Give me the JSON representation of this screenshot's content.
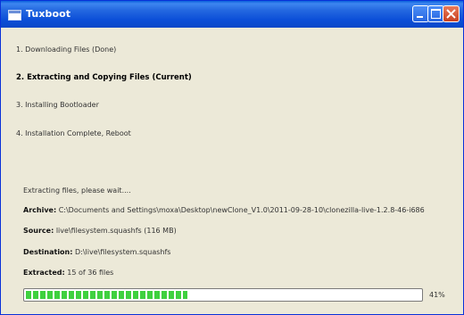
{
  "window": {
    "title": "Tuxboot",
    "controls": {
      "minimize_icon": "minimize-icon",
      "maximize_icon": "maximize-icon",
      "close_icon": "close-icon"
    },
    "colors": {
      "titlebar": "#0c4fd8",
      "body": "#ece9d8",
      "progress_fill": "#3fd13f"
    }
  },
  "steps": [
    {
      "label": "1. Downloading Files (Done)",
      "current": false
    },
    {
      "label": "2. Extracting and Copying Files (Current)",
      "current": true
    },
    {
      "label": "3. Installing Bootloader",
      "current": false
    },
    {
      "label": "4. Installation Complete, Reboot",
      "current": false
    }
  ],
  "status": {
    "message": "Extracting files, please wait....",
    "archive_label": "Archive:",
    "archive_value": "C:\\Documents and Settings\\moxa\\Desktop\\newClone_V1.0\\2011-09-28-10\\clonezilla-live-1.2.8-46-i686",
    "source_label": "Source:",
    "source_value": "live\\filesystem.squashfs (116 MB)",
    "destination_label": "Destination:",
    "destination_value": "D:\\live\\filesystem.squashfs",
    "extracted_label": "Extracted:",
    "extracted_value": "15 of 36 files"
  },
  "progress": {
    "fraction": 0.41,
    "percent_label": "41%"
  }
}
